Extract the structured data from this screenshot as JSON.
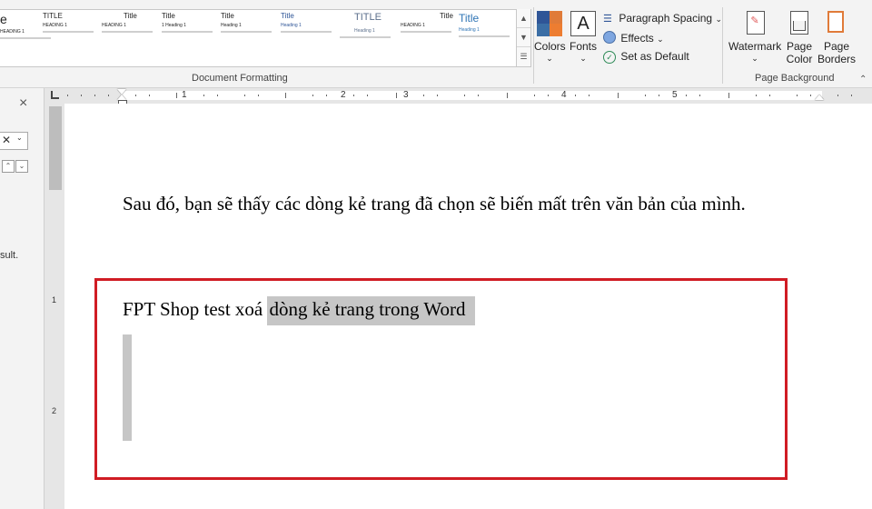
{
  "ribbon": {
    "gallery": {
      "items": [
        {
          "title": "e",
          "sub": "HEADING 1",
          "title_color": "#222222"
        },
        {
          "title": "TITLE",
          "sub": "HEADING 1",
          "title_color": "#222222"
        },
        {
          "title": "Title",
          "sub": "HEADING 1",
          "title_color": "#222222"
        },
        {
          "title": "Title",
          "sub": "1 Heading 1",
          "title_color": "#222222"
        },
        {
          "title": "Title",
          "sub": "Heading 1",
          "title_color": "#222222"
        },
        {
          "title": "Title",
          "sub": "Heading 1",
          "title_color": "#2e5597"
        },
        {
          "title": "TITLE",
          "sub": "Heading 1",
          "title_color": "#5b6f8c"
        },
        {
          "title": "Title",
          "sub": "HEADING 1",
          "title_color": "#222222"
        },
        {
          "title": "Title",
          "sub": "Heading 1",
          "title_color": "#2e74b5"
        }
      ]
    },
    "document_formatting_label": "Document Formatting",
    "colors_label": "Colors",
    "fonts_label": "Fonts",
    "fonts_glyph": "A",
    "paragraph_spacing_label": "Paragraph Spacing",
    "effects_label": "Effects",
    "set_default_label": "Set as Default",
    "watermark_label": "Watermark",
    "page_color_label": "Page Color",
    "page_borders_label": "Page Borders",
    "page_background_label": "Page Background",
    "accent_colors": [
      "#2f5597",
      "#e07b39",
      "#3b6ea5",
      "#ed7d31"
    ]
  },
  "side_pane": {
    "close_glyph": "×",
    "partial_text": "sult."
  },
  "ruler": {
    "numbers": [
      "1",
      "2",
      "3",
      "4",
      "5"
    ],
    "vertical_numbers": [
      "1",
      "2"
    ]
  },
  "document": {
    "line1": "Sau đó, bạn sẽ thấy các dòng kẻ trang đã chọn sẽ biến mất trên văn bản của mình.",
    "line2_plain": "FPT Shop test xoá ",
    "line2_highlight": "dòng kẻ trang trong Word"
  }
}
